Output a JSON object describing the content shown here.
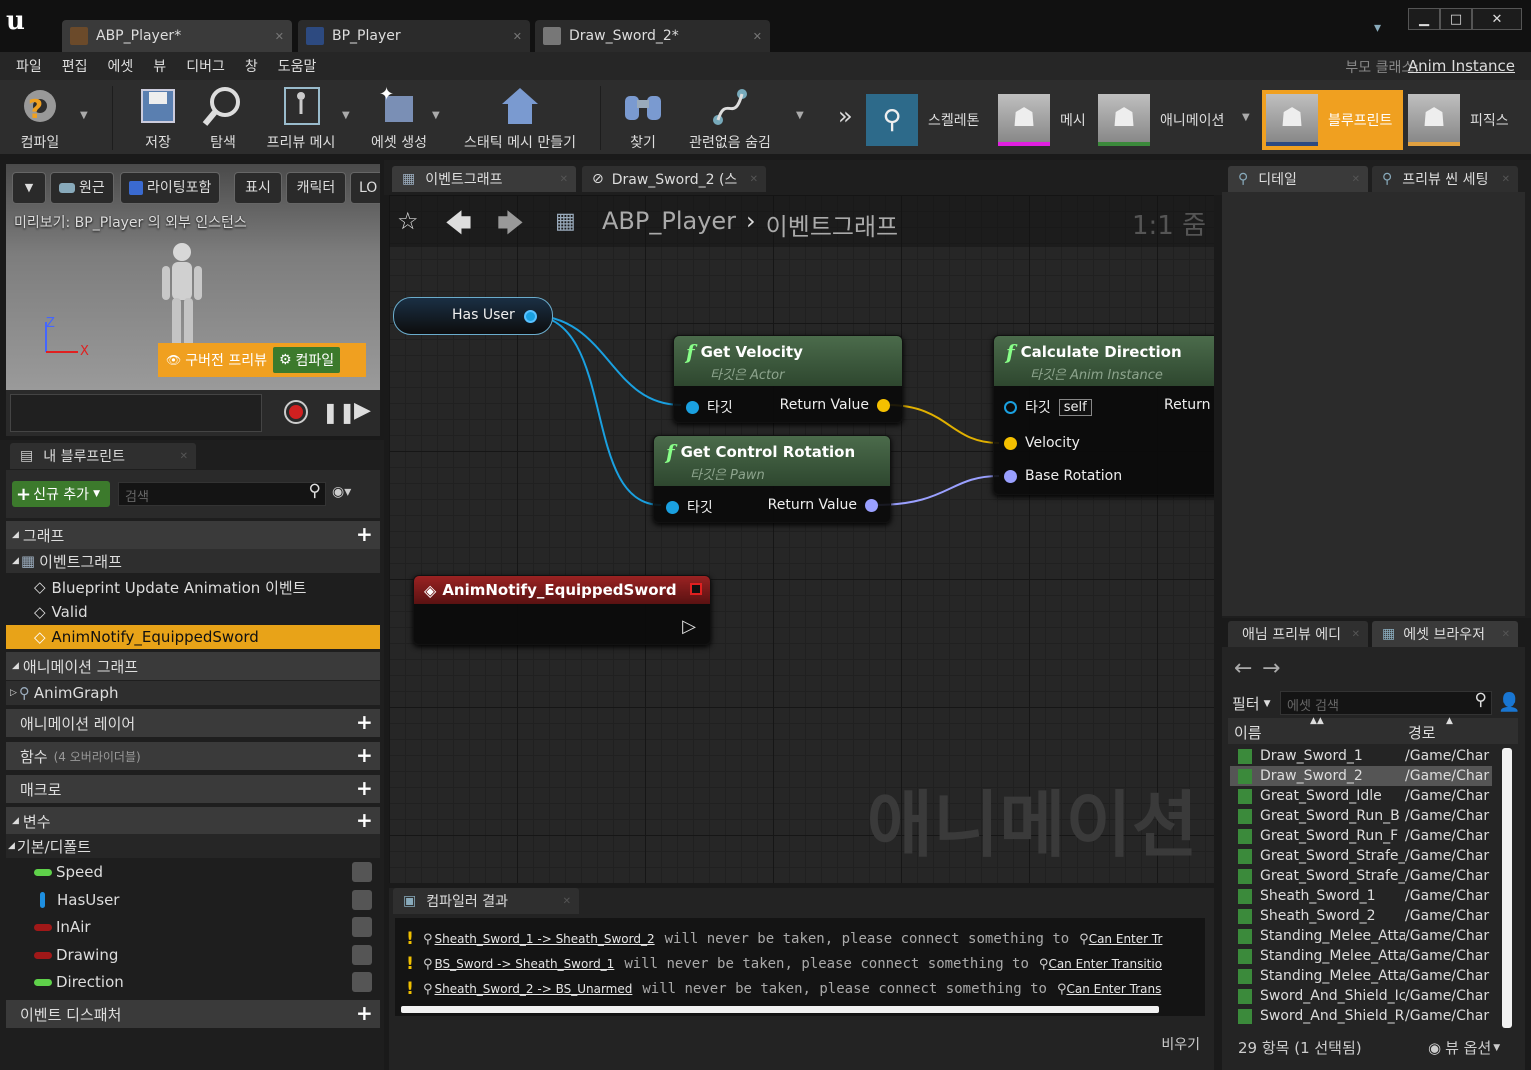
{
  "window": {
    "logo": "u",
    "tabs": [
      {
        "label": "ABP_Player*"
      },
      {
        "label": "BP_Player"
      },
      {
        "label": "Draw_Sword_2*"
      }
    ],
    "min": "▁",
    "max": "□",
    "close": "✕"
  },
  "menu": {
    "items": [
      "파일",
      "편집",
      "에셋",
      "뷰",
      "디버그",
      "창",
      "도움말"
    ],
    "parent_class_label": "부모 클래스:",
    "parent_class_value": "Anim Instance"
  },
  "toolbar": {
    "compile": "컴파일",
    "save": "저장",
    "browse": "탐색",
    "preview_mesh": "프리뷰 메시",
    "asset_create": "에셋 생성",
    "static_mesh": "스태틱 메시 만들기",
    "find": "찾기",
    "hide_unrelated": "관련없음 숨김",
    "more": "»",
    "modes": [
      {
        "label": "스켈레톤"
      },
      {
        "label": "메시"
      },
      {
        "label": "애니메이션"
      },
      {
        "label": "블루프린트",
        "active": true
      },
      {
        "label": "피직스"
      }
    ]
  },
  "viewport": {
    "btn_perspective": "원근",
    "btn_lighting": "라이팅포함",
    "btn_show": "표시",
    "btn_character": "캐릭터",
    "btn_lod": "LO",
    "preview_text": "미리보기: BP_Player 의 외부 인스턴스",
    "axis_z": "Z",
    "axis_x": "X",
    "old_preview": "구버전 프리뷰",
    "compile": "컴파일"
  },
  "my_blueprint": {
    "tab": "내 블루프린트",
    "add_new": "신규 추가",
    "search_placeholder": "검색",
    "graphs_header": "그래프",
    "event_graph": "이벤트그래프",
    "events": [
      "Blueprint Update Animation 이벤트",
      "Valid",
      "AnimNotify_EquippedSword"
    ],
    "anim_graphs_header": "애니메이션 그래프",
    "anim_graph": "AnimGraph",
    "anim_layers": "애니메이션 레이어",
    "functions": "함수",
    "functions_note": "(4 오버라이더블)",
    "macros": "매크로",
    "variables": "변수",
    "defaults": "기본/디폴트",
    "vars": [
      {
        "name": "Speed",
        "color": "#5fd14a"
      },
      {
        "name": "HasUser",
        "color": "#1e8fe0"
      },
      {
        "name": "InAir",
        "color": "#a01818"
      },
      {
        "name": "Drawing",
        "color": "#a01818"
      },
      {
        "name": "Direction",
        "color": "#5fd14a"
      }
    ],
    "dispatchers": "이벤트 디스패처"
  },
  "editor_tabs": {
    "event_graph": "이벤트그래프",
    "draw_sword": "Draw_Sword_2 (스"
  },
  "graph": {
    "breadcrumb_root": "ABP_Player",
    "breadcrumb_sep": "›",
    "breadcrumb_current": "이벤트그래프",
    "zoom": "1:1 줌",
    "watermark": "애니메이션",
    "has_user": "Has User",
    "get_velocity": {
      "title": "Get Velocity",
      "subtitle": "타깃은 Actor",
      "in": "타깃",
      "out": "Return Value"
    },
    "get_control_rotation": {
      "title": "Get Control Rotation",
      "subtitle": "타깃은 Pawn",
      "in": "타깃",
      "out": "Return Value"
    },
    "calc_direction": {
      "title": "Calculate Direction",
      "subtitle": "타깃은 Anim Instance",
      "target": "타깃",
      "self": "self",
      "return": "Return",
      "velocity": "Velocity",
      "base_rotation": "Base Rotation"
    },
    "anim_notify": {
      "title": "AnimNotify_EquippedSword"
    }
  },
  "right": {
    "details_tab": "디테일",
    "preview_scene_tab": "프리뷰 씬 세팅",
    "anim_preview_tab": "애님 프리뷰 에디",
    "asset_browser_tab": "에셋 브라우저",
    "filter": "필터",
    "asset_search_placeholder": "에셋 검색",
    "col_name": "이름",
    "col_path": "경로",
    "assets": [
      {
        "name": "Draw_Sword_1",
        "path": "/Game/Char"
      },
      {
        "name": "Draw_Sword_2",
        "path": "/Game/Char",
        "selected": true
      },
      {
        "name": "Great_Sword_Idle",
        "path": "/Game/Char"
      },
      {
        "name": "Great_Sword_Run_B",
        "path": "/Game/Char"
      },
      {
        "name": "Great_Sword_Run_F",
        "path": "/Game/Char"
      },
      {
        "name": "Great_Sword_Strafe_L",
        "path": "/Game/Char"
      },
      {
        "name": "Great_Sword_Strafe_R",
        "path": "/Game/Char"
      },
      {
        "name": "Sheath_Sword_1",
        "path": "/Game/Char"
      },
      {
        "name": "Sheath_Sword_2",
        "path": "/Game/Char"
      },
      {
        "name": "Standing_Melee_Atta",
        "path": "/Game/Char"
      },
      {
        "name": "Standing_Melee_Atta",
        "path": "/Game/Char"
      },
      {
        "name": "Standing_Melee_Atta",
        "path": "/Game/Char"
      },
      {
        "name": "Sword_And_Shield_Ic",
        "path": "/Game/Char"
      },
      {
        "name": "Sword_And_Shield_R",
        "path": "/Game/Char"
      }
    ],
    "count": "29 항목 (1 선택됨)",
    "view_options": "뷰 옵션"
  },
  "compiler": {
    "tab": "컴파일러 결과",
    "clear": "비우기",
    "rows": [
      {
        "link": "Sheath_Sword_1 -> Sheath_Sword_2",
        "msg": "will never be taken, please connect something to",
        "target": "Can Enter Tr"
      },
      {
        "link": "BS_Sword -> Sheath_Sword_1",
        "msg": "will never be taken, please connect something to",
        "target": "Can Enter Transitio"
      },
      {
        "link": "Sheath_Sword_2 -> BS_Unarmed",
        "msg": "will never be taken, please connect something to",
        "target": "Can Enter Trans"
      }
    ]
  },
  "colors": {
    "accent": "#f0a020",
    "selected_row": "#e8a318",
    "exec_red": "#8a1c1c",
    "function_green": "#3f613f",
    "bool_pin": "#1e8fe0",
    "vector_pin": "#f5c000",
    "rotator_pin": "#9aa0ff"
  }
}
